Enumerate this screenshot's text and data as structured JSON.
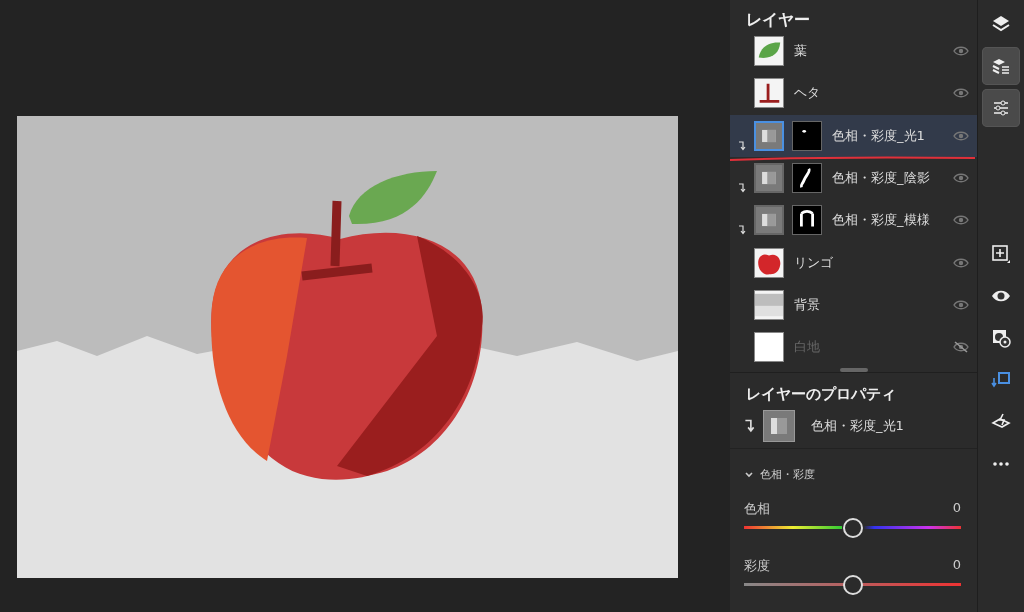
{
  "layers_panel": {
    "title": "レイヤー",
    "layers": [
      {
        "name": "葉",
        "kind": "pixel",
        "thumbnail": {
          "kind": "leaf"
        },
        "clipped": false,
        "visible": true,
        "selected": false
      },
      {
        "name": "ヘタ",
        "kind": "pixel",
        "thumbnail": {
          "kind": "stem"
        },
        "clipped": false,
        "visible": true,
        "selected": false
      },
      {
        "name": "色相・彩度_光1",
        "kind": "adjustment",
        "thumbnail": {
          "kind": "spot"
        },
        "clipped": true,
        "visible": true,
        "selected": true
      },
      {
        "name": "色相・彩度_陰影",
        "kind": "adjustment",
        "thumbnail": {
          "kind": "stroke"
        },
        "clipped": true,
        "visible": true,
        "selected": false
      },
      {
        "name": "色相・彩度_模様",
        "kind": "adjustment",
        "thumbnail": {
          "kind": "arch"
        },
        "clipped": true,
        "visible": true,
        "selected": false
      },
      {
        "name": "リンゴ",
        "kind": "pixel",
        "thumbnail": {
          "kind": "apple"
        },
        "clipped": false,
        "visible": true,
        "selected": false
      },
      {
        "name": "背景",
        "kind": "pixel",
        "thumbnail": {
          "kind": "background"
        },
        "clipped": false,
        "visible": true,
        "selected": false
      },
      {
        "name": "白地",
        "kind": "pixel",
        "thumbnail": {
          "kind": "blank"
        },
        "clipped": false,
        "visible": false,
        "selected": false
      }
    ]
  },
  "properties_panel": {
    "title": "レイヤーのプロパティ",
    "layer_name": "色相・彩度_光1",
    "clipped": true,
    "section": {
      "title": "色相・彩度",
      "expanded": true,
      "sliders": [
        {
          "label": "色相",
          "reading": "0",
          "kind": "hue",
          "level": 0.5
        },
        {
          "label": "彩度",
          "reading": "0",
          "kind": "saturation",
          "level": 0.5
        }
      ]
    }
  },
  "toolbar": {
    "top": [
      {
        "kind": "layers",
        "selected": false
      },
      {
        "kind": "layer-list",
        "selected": true
      },
      {
        "kind": "adjust",
        "selected": true
      }
    ],
    "bottom": [
      {
        "kind": "add-layer",
        "selected": false
      },
      {
        "kind": "visibility",
        "selected": false
      },
      {
        "kind": "mask",
        "selected": false
      },
      {
        "kind": "clip",
        "selected": false
      },
      {
        "kind": "erase",
        "selected": false
      },
      {
        "kind": "more",
        "selected": false
      }
    ]
  }
}
